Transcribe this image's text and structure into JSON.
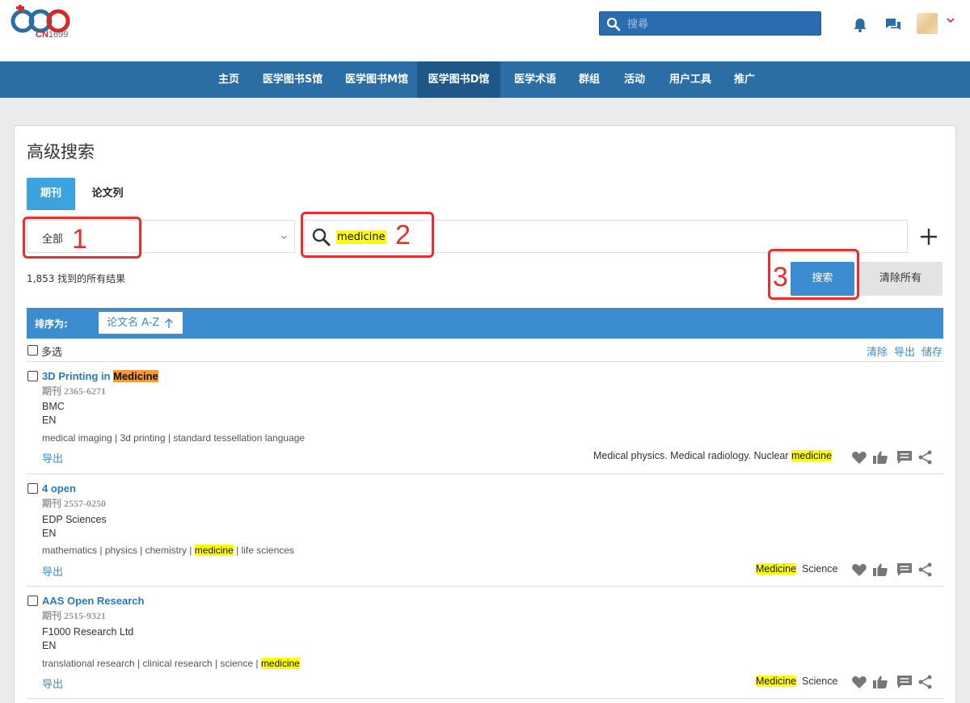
{
  "header": {
    "logo_brand": "CN",
    "logo_num": "1699",
    "search_placeholder": "搜尋",
    "colors": {
      "brand_red": "#d9262b",
      "nav_blue": "#2b6ea6",
      "accent": "#3c8dcf"
    }
  },
  "nav": [
    {
      "label": "主页",
      "active": false
    },
    {
      "label": "医学图书S馆",
      "active": false
    },
    {
      "label": "医学图书M馆",
      "active": false
    },
    {
      "label": "医学图书D馆",
      "active": true
    },
    {
      "label": "医学术语",
      "active": false
    },
    {
      "label": "群组",
      "active": false
    },
    {
      "label": "活动",
      "active": false
    },
    {
      "label": "用户工具",
      "active": false
    },
    {
      "label": "推广",
      "active": false
    }
  ],
  "page": {
    "title": "高级搜索",
    "tabs": [
      {
        "label": "期刊",
        "active": true
      },
      {
        "label": "论文列",
        "active": false
      }
    ],
    "scope_value": "全部",
    "query_value": "medicine",
    "result_count": "1,853 找到的所有结果",
    "search_button": "搜索",
    "clear_button": "清除所有",
    "sort_label": "排序为:",
    "sort_value": "论文名 A-Z",
    "multiselect": "多选",
    "links": {
      "clear": "清除",
      "export": "导出",
      "save": "储存"
    }
  },
  "annotations": [
    "1",
    "2",
    "3"
  ],
  "results": [
    {
      "title_pre": "3D Printing in ",
      "title_hl": "Medicine",
      "issn": "期刊 2365-6271",
      "publisher": "BMC",
      "language": "EN",
      "keywords": "medical imaging | 3d printing | standard tessellation language",
      "export": "导出",
      "subject_pre": "Medical physics. Medical radiology. Nuclear ",
      "subject_hl": "medicine"
    },
    {
      "title": "4 open",
      "issn": "期刊 2557-0250",
      "publisher": "EDP Sciences",
      "language": "EN",
      "keywords_pre": "mathematics | physics | chemistry | ",
      "keywords_hl": "medicine",
      "keywords_post": " | life sciences",
      "export": "导出",
      "subject_hl": "Medicine",
      "subject_post": "Science"
    },
    {
      "title": "AAS Open Research",
      "issn": "期刊 2515-9321",
      "publisher": "F1000 Research Ltd",
      "language": "EN",
      "keywords_pre": "translational research | clinical research | science | ",
      "keywords_hl": "medicine",
      "export": "导出",
      "subject_hl": "Medicine",
      "subject_post": "Science"
    }
  ]
}
